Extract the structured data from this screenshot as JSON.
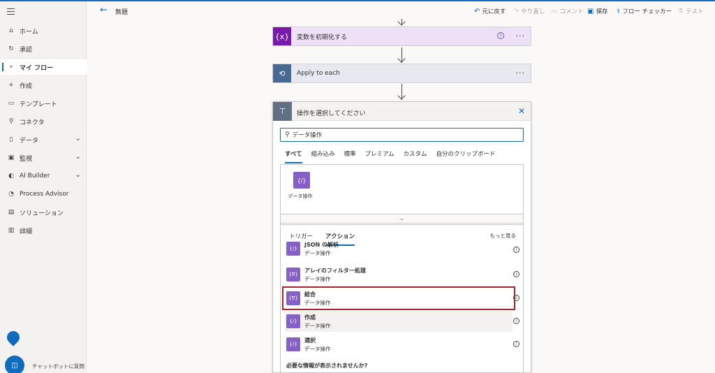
{
  "header": {
    "flow_name": "無題",
    "undo": "元に戻す",
    "redo": "やり直し",
    "comment": "コメント",
    "save": "保存",
    "checker": "フロー チェッカー",
    "test": "テスト"
  },
  "sidebar": {
    "items": [
      {
        "label": "ホーム",
        "icon": "home-icon"
      },
      {
        "label": "承認",
        "icon": "approval-icon"
      },
      {
        "label": "マイ フロー",
        "icon": "flow-icon"
      },
      {
        "label": "作成",
        "icon": "plus-icon"
      },
      {
        "label": "テンプレート",
        "icon": "template-icon"
      },
      {
        "label": "コネクタ",
        "icon": "connector-icon"
      },
      {
        "label": "データ",
        "icon": "database-icon"
      },
      {
        "label": "監視",
        "icon": "monitor-icon"
      },
      {
        "label": "AI Builder",
        "icon": "ai-icon"
      },
      {
        "label": "Process Advisor",
        "icon": "process-icon"
      },
      {
        "label": "ソリューション",
        "icon": "solution-icon"
      },
      {
        "label": "詳細",
        "icon": "book-icon"
      }
    ],
    "chatbot": "チャットボットに質問"
  },
  "canvas": {
    "card1_title": "変数を初期化する",
    "card2_title": "Apply to each",
    "panel_title": "操作を選択してください",
    "search_value": "データ操作",
    "tabs": [
      "すべて",
      "組み込み",
      "標準",
      "プレミアム",
      "カスタム",
      "自分のクリップボード"
    ],
    "connector_label": "データ操作",
    "subtabs": [
      "トリガー",
      "アクション"
    ],
    "more": "もっと見る",
    "actions": [
      {
        "name": "JSON の解析",
        "sub": "データ操作"
      },
      {
        "name": "アレイのフィルター処理",
        "sub": "データ操作"
      },
      {
        "name": "結合",
        "sub": "データ操作"
      },
      {
        "name": "作成",
        "sub": "データ操作"
      },
      {
        "name": "選択",
        "sub": "データ操作"
      }
    ],
    "missing": "必要な情報が表示されませんか?"
  },
  "colors": {
    "accent": "#0f6cbd",
    "variable_purple": "#7719aa",
    "data_ops_purple": "#8661c5",
    "highlight_red": "#a4262c"
  }
}
